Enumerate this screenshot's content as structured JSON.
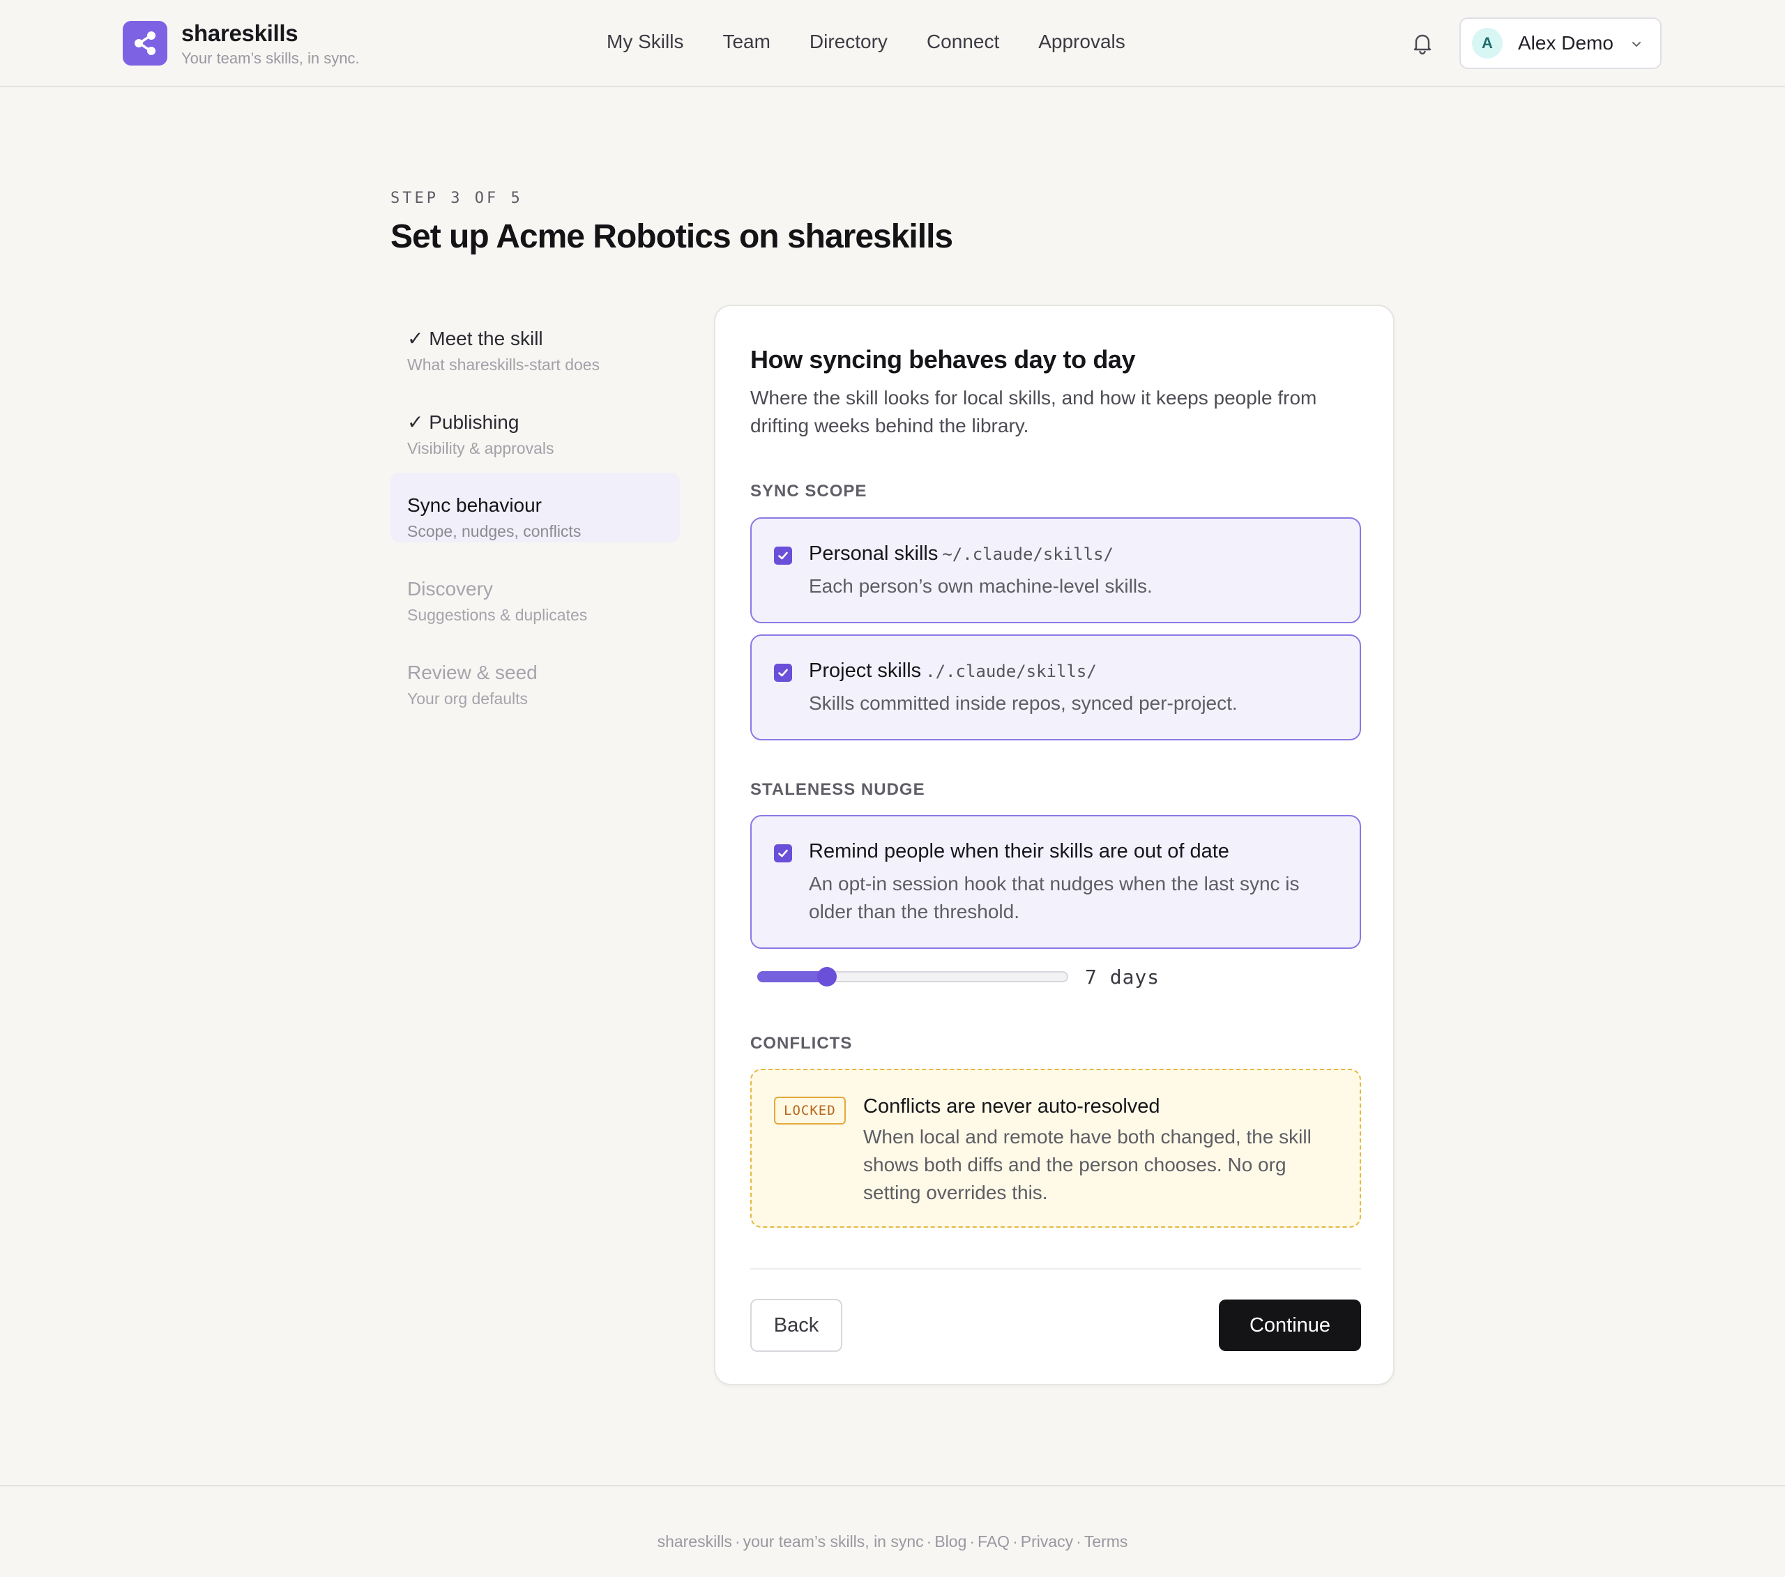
{
  "brand": {
    "name": "shareskills",
    "tagline": "Your team’s skills, in sync."
  },
  "nav": [
    "My Skills",
    "Team",
    "Directory",
    "Connect",
    "Approvals"
  ],
  "user": {
    "initial": "A",
    "name": "Alex Demo"
  },
  "step_label": "STEP 3 OF 5",
  "page_title": "Set up Acme Robotics on shareskills",
  "steps": [
    {
      "title": "✓ Meet the skill",
      "subtitle": "What shareskills-start does",
      "state": "done"
    },
    {
      "title": "✓ Publishing",
      "subtitle": "Visibility & approvals",
      "state": "done"
    },
    {
      "title": "Sync behaviour",
      "subtitle": "Scope, nudges, conflicts",
      "state": "active"
    },
    {
      "title": "Discovery",
      "subtitle": "Suggestions & duplicates",
      "state": "future"
    },
    {
      "title": "Review & seed",
      "subtitle": "Your org defaults",
      "state": "future"
    }
  ],
  "card": {
    "title": "How syncing behaves day to day",
    "description": "Where the skill looks for local skills, and how it keeps people from drifting weeks behind the library.",
    "sync_scope": {
      "label": "SYNC SCOPE",
      "options": [
        {
          "title": "Personal skills",
          "path": "~/.claude/skills/",
          "description": "Each person’s own machine-level skills.",
          "checked": true
        },
        {
          "title": "Project skills",
          "path": "./.claude/skills/",
          "description": "Skills committed inside repos, synced per-project.",
          "checked": true
        }
      ]
    },
    "staleness": {
      "label": "STALENESS NUDGE",
      "title": "Remind people when their skills are out of date",
      "description": "An opt-in session hook that nudges when the last sync is older than the threshold.",
      "checked": true,
      "slider_value": 7,
      "slider_text": "7 days"
    },
    "conflicts": {
      "label": "CONFLICTS",
      "tag": "LOCKED",
      "title": "Conflicts are never auto-resolved",
      "description": "When local and remote have both changed, the skill shows both diffs and the person chooses. No org setting overrides this."
    },
    "back_label": "Back",
    "continue_label": "Continue"
  },
  "footer": {
    "brand": "shareskills",
    "tagline": "your team’s skills, in sync",
    "links": [
      "Blog",
      "FAQ",
      "Privacy",
      "Terms"
    ],
    "separator": "·"
  },
  "colors": {
    "accent": "#7d63e3",
    "checkbox": "#6a4fd8",
    "locked": "#e6b840"
  }
}
